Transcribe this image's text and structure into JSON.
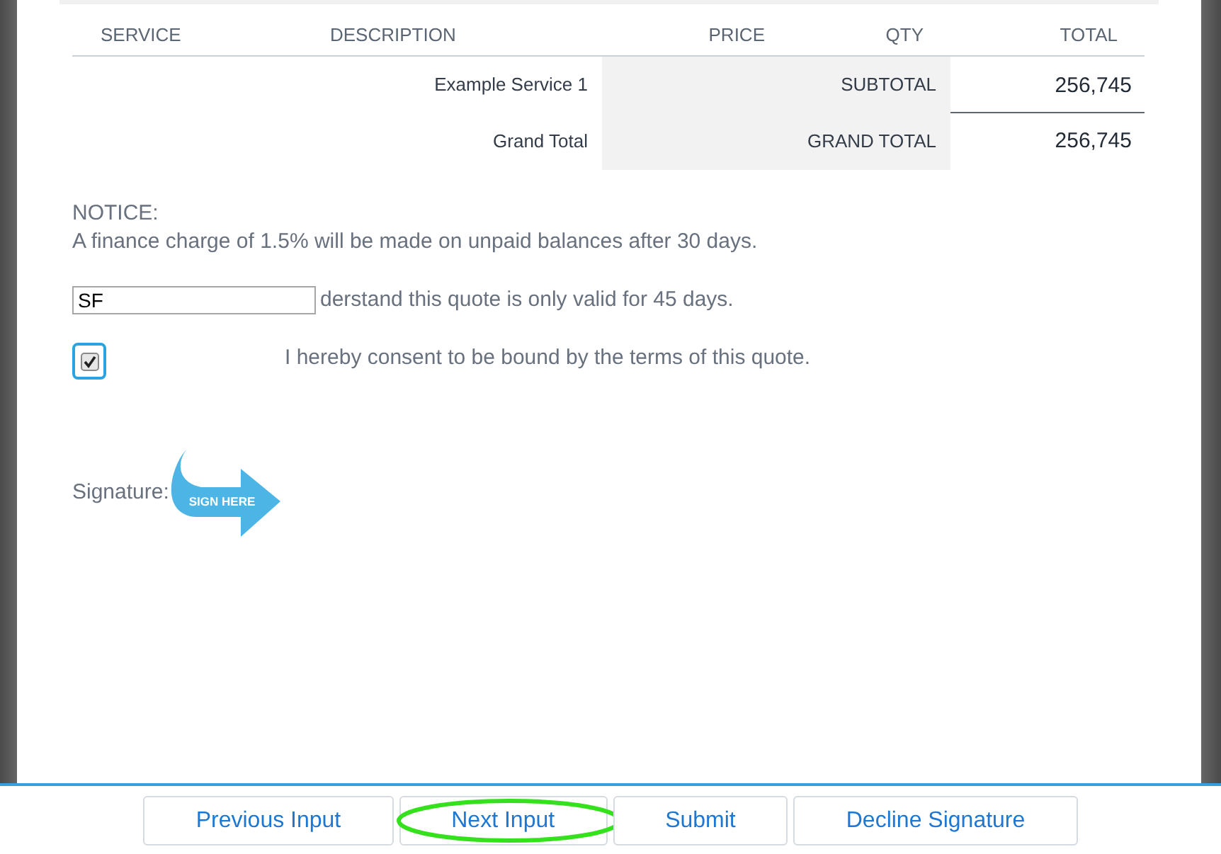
{
  "table": {
    "columns": [
      "SERVICE",
      "DESCRIPTION",
      "PRICE",
      "QTY",
      "TOTAL"
    ],
    "rows": [
      {
        "kind": "subtotal",
        "description": "Example Service 1",
        "summary_label": "SUBTOTAL",
        "total": "256,745"
      },
      {
        "kind": "grand_total",
        "description": "Grand Total",
        "summary_label": "GRAND TOTAL",
        "total": "256,745"
      }
    ]
  },
  "notice": {
    "heading": "NOTICE:",
    "text": "A finance charge of 1.5% will be made on unpaid balances after 30 days."
  },
  "initials": {
    "value": "SF",
    "text": "derstand this quote is only valid for 45 days."
  },
  "consent": {
    "checked": true,
    "focused": true,
    "label": "I hereby consent to be bound by the terms of this quote."
  },
  "signature": {
    "label": "Signature:",
    "tag": "SIGN HERE"
  },
  "toolbar": {
    "buttons": [
      {
        "label": "Previous Input",
        "highlighted": false
      },
      {
        "label": "Next Input",
        "highlighted": true
      },
      {
        "label": "Submit",
        "highlighted": false
      },
      {
        "label": "Decline Signature",
        "highlighted": false
      }
    ]
  }
}
